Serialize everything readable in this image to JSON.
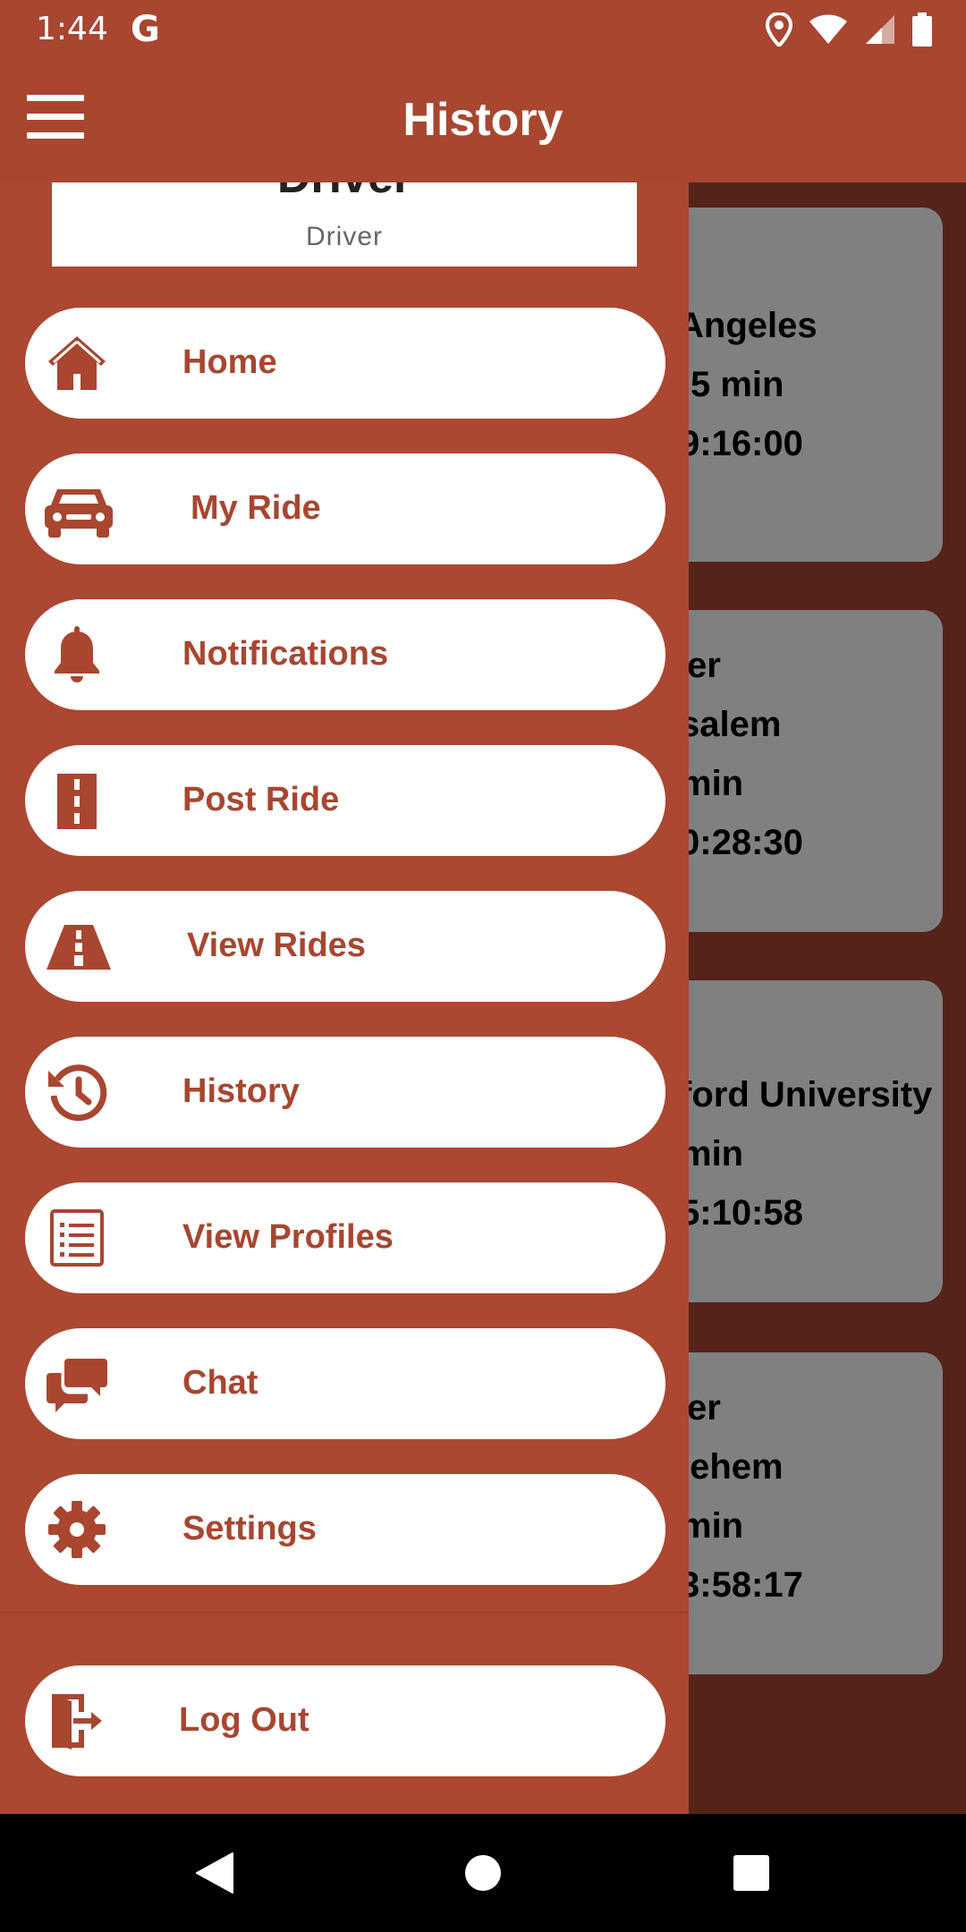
{
  "status_bar": {
    "time": "1:44",
    "g_label": "G",
    "icons": [
      "location-icon",
      "wifi-icon",
      "signal-icon",
      "battery-icon"
    ]
  },
  "app_bar": {
    "title": "History",
    "menu_icon": "hamburger-menu-icon"
  },
  "colors": {
    "primary": "#a84630",
    "drawer": "#ac4731",
    "scrim_content": "#55231a",
    "card": "#808080",
    "pill": "#ffffff"
  },
  "background_rides": [
    {
      "lines": [
        "Angeles",
        "5 min",
        "9:16:00"
      ]
    },
    {
      "lines": [
        "er",
        "salem",
        " min",
        "0:28:30"
      ]
    },
    {
      "lines": [
        "ford University",
        " min",
        "5:10:58"
      ]
    },
    {
      "lines": [
        "er",
        "lehem",
        "min",
        "3:58:17"
      ]
    }
  ],
  "drawer": {
    "profile": {
      "name": "Driver",
      "role": "Driver"
    },
    "items": [
      {
        "label": "Home",
        "icon": "home-icon"
      },
      {
        "label": "My Ride",
        "icon": "car-icon"
      },
      {
        "label": "Notifications",
        "icon": "bell-icon"
      },
      {
        "label": "Post Ride",
        "icon": "road-icon"
      },
      {
        "label": "View Rides",
        "icon": "highway-icon"
      },
      {
        "label": "History",
        "icon": "history-icon"
      },
      {
        "label": "View Profiles",
        "icon": "list-icon"
      },
      {
        "label": "Chat",
        "icon": "chat-icon"
      },
      {
        "label": "Settings",
        "icon": "gear-icon"
      }
    ],
    "logout": {
      "label": "Log Out",
      "icon": "logout-icon"
    }
  },
  "nav_bar": {
    "buttons": [
      "back-icon",
      "home-circle-icon",
      "recents-icon"
    ]
  }
}
